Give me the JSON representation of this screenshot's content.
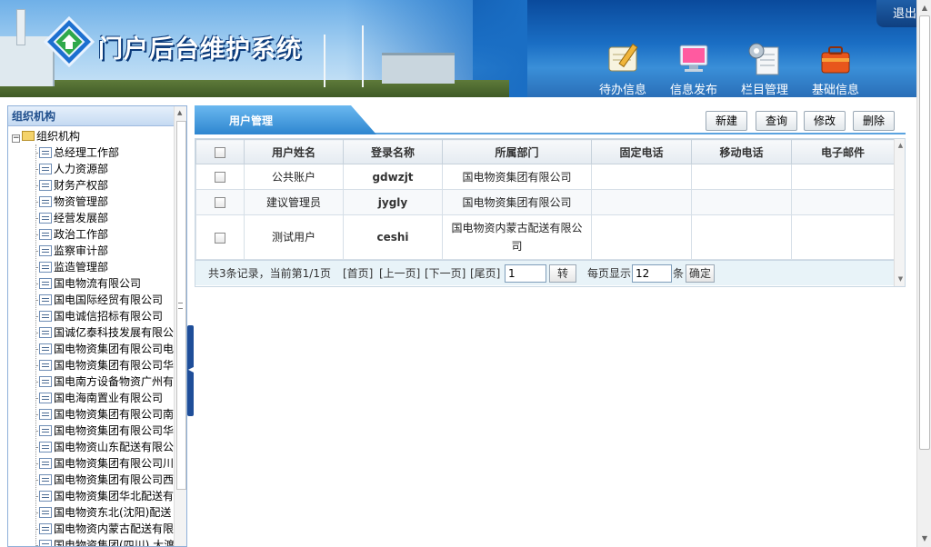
{
  "header": {
    "title": "门户后台维护系统",
    "nav": [
      {
        "label": "待办信息",
        "icon": "notebook-pen-icon"
      },
      {
        "label": "信息发布",
        "icon": "monitor-icon"
      },
      {
        "label": "栏目管理",
        "icon": "document-gear-icon"
      },
      {
        "label": "基础信息",
        "icon": "toolbox-icon"
      }
    ],
    "exit_label": "退出",
    "colors": {
      "banner": "#1a6ec4",
      "accent": "#2e86d0"
    }
  },
  "sidebar": {
    "title": "组织机构",
    "root": "组织机构",
    "items": [
      "总经理工作部",
      "人力资源部",
      "财务产权部",
      "物资管理部",
      "经营发展部",
      "政治工作部",
      "监察审计部",
      "监造管理部",
      "国电物流有限公司",
      "国电国际经贸有限公司",
      "国电诚信招标有限公司",
      "国诚亿泰科技发展有限公",
      "国电物资集团有限公司电",
      "国电物资集团有限公司华",
      "国电南方设备物资广州有",
      "国电海南置业有限公司",
      "国电物资集团有限公司南",
      "国电物资集团有限公司华",
      "国电物资山东配送有限公",
      "国电物资集团有限公司川",
      "国电物资集团有限公司西",
      "国电物资集团华北配送有",
      "国电物资东北(沈阳)配送",
      "国电物资内蒙古配送有限",
      "国电物资集团(四川) 大渡"
    ]
  },
  "main": {
    "tab_label": "用户管理",
    "toolbar": {
      "new": "新建",
      "query": "查询",
      "edit": "修改",
      "delete": "删除"
    },
    "table": {
      "columns": [
        "用户姓名",
        "登录名称",
        "所属部门",
        "固定电话",
        "移动电话",
        "电子邮件"
      ],
      "rows": [
        {
          "name": "公共账户",
          "login": "gdwzjt",
          "dept": "国电物资集团有限公司",
          "phone": "",
          "mobile": "",
          "email": ""
        },
        {
          "name": "建议管理员",
          "login": "jygly",
          "dept": "国电物资集团有限公司",
          "phone": "",
          "mobile": "",
          "email": ""
        },
        {
          "name": "测试用户",
          "login": "ceshi",
          "dept": "国电物资内蒙古配送有限公司",
          "phone": "",
          "mobile": "",
          "email": ""
        }
      ]
    },
    "pager": {
      "summary": "共3条记录，当前第1/1页",
      "first": "[首页]",
      "prev": "[上一页]",
      "next": "[下一页]",
      "last": "[尾页]",
      "page_value": "1",
      "go": "转",
      "per_page_label": "每页显示",
      "per_page_value": "12",
      "per_page_unit": "条",
      "confirm": "确定"
    }
  }
}
